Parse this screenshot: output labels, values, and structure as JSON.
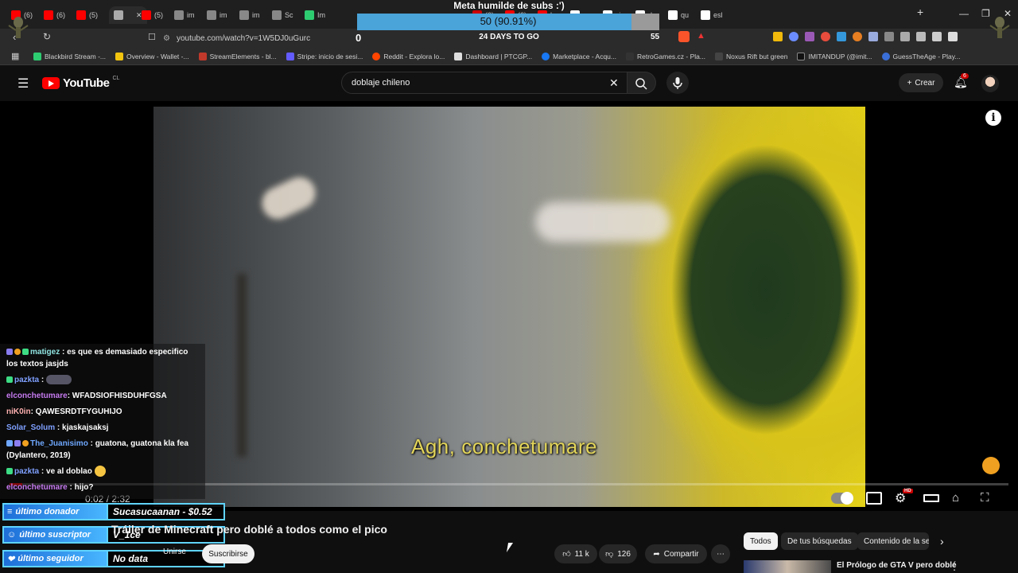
{
  "overlay": {
    "goal_title": "Meta humilde de subs :')",
    "goal_value": "50 (90.91%)",
    "goal_fraction": 0.9091,
    "goal_left": "0",
    "goal_days": "24 DAYS TO GO",
    "goal_right": "55"
  },
  "browser": {
    "tabs": [
      {
        "label": "(6)",
        "active": false
      },
      {
        "label": "(6)",
        "active": false
      },
      {
        "label": "(5)",
        "active": false
      },
      {
        "label": "",
        "active": true
      },
      {
        "label": "(5)",
        "active": false
      },
      {
        "label": "im",
        "active": false
      },
      {
        "label": "im",
        "active": false
      },
      {
        "label": "im",
        "active": false
      },
      {
        "label": "Sc",
        "active": false
      },
      {
        "label": "Im",
        "active": false
      },
      {
        "label": "(6)",
        "active": false
      },
      {
        "label": "(6)",
        "active": false
      },
      {
        "label": "lav",
        "active": false
      },
      {
        "label": "go",
        "active": false
      },
      {
        "label": "vic",
        "active": false
      },
      {
        "label": "de",
        "active": false
      },
      {
        "label": "qu",
        "active": false
      },
      {
        "label": "esl",
        "active": false
      }
    ],
    "url": "youtube.com/watch?v=1W5DJ0uGurc",
    "bookmarks": [
      "Blackbird Stream -...",
      "Overview - Wallet -...",
      "StreamElements - bl...",
      "Stripe: inicio de sesi...",
      "Reddit - Explora lo...",
      "Dashboard | PTCGP...",
      "Marketplace - Acqu...",
      "RetroGames.cz - Pla...",
      "Noxus Rift but green",
      "IMITANDUP (@imit...",
      "GuessTheAge - Play..."
    ]
  },
  "youtube": {
    "logo": "YouTube",
    "country": "CL",
    "search_value": "doblaje chileno",
    "create_label": "Crear",
    "notif_count": "6"
  },
  "player": {
    "subtitle": "Agh, conchetumare",
    "time": "0:02 / 2:32",
    "progress": 0.013,
    "info": "i"
  },
  "chat": [
    {
      "user": "matigez",
      "text": ": es que es demasiado especifico los textos jasjds"
    },
    {
      "user": "pazkta",
      "text": ":"
    },
    {
      "user": "elconchetumare",
      "text": ": WFADSIOFHISDUHFGSA"
    },
    {
      "user": "niK0in",
      "text": ": QAWESRDTFYGUHIJO"
    },
    {
      "user": "Solar_Solum",
      "text": ": kjaskajsaksj"
    },
    {
      "user": "The_Juanisimo",
      "text": ": guatona, guatona kla fea (Dylantero, 2019)"
    },
    {
      "user": "pazkta",
      "text": ": ve al doblao"
    },
    {
      "user": "elconchetumare",
      "text": ": hijo?"
    }
  ],
  "alerts": {
    "donor_label": "último donador",
    "donor_value": "Sucasucaanan - $0.52",
    "sub_label": "último suscriptor",
    "sub_value": "V_1ce",
    "follower_label": "último seguidor",
    "follower_value": "No data"
  },
  "video": {
    "title": "Tráiler de Minecraft pero doblé a todos como el pico",
    "join_label": "Unirse",
    "subscribe_label": "Suscribirse",
    "likes": "11 k",
    "dislikes": "126",
    "share_label": "Compartir",
    "more_label": "⋯"
  },
  "sidebar": {
    "chips": [
      "Todos",
      "De tus búsquedas",
      "Contenido de la ser"
    ],
    "rec_title": "El Prólogo de GTA V pero doblé"
  },
  "colors": {
    "accent_red": "#ff0000",
    "goal_fill": "#4aa3d9",
    "subtitle": "#e3d55a",
    "alert_blue": "#1e6fd8"
  }
}
